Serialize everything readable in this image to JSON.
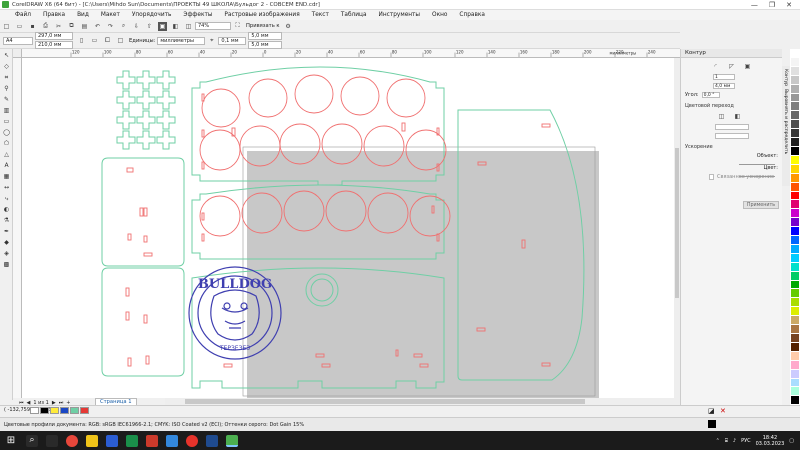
{
  "titlebar": {
    "title": "CorelDRAW X6 (64 бит) - [C:\\Users\\Mihdo Sun\\Documents\\ПРОЕКТЫ 49 ШКОЛА\\Бульдог 2 - СОВСЕМ END.cdr]",
    "minimize": "—",
    "maximize": "❐",
    "close": "✕"
  },
  "menu": [
    "Файл",
    "Правка",
    "Вид",
    "Макет",
    "Упорядочить",
    "Эффекты",
    "Растровые изображения",
    "Текст",
    "Таблица",
    "Инструменты",
    "Окно",
    "Справка"
  ],
  "toolbar": {
    "zoom": "74%",
    "snap": "Привязать к"
  },
  "propbar": {
    "page_size": "A4",
    "width": "297,0 мм",
    "height": "210,0 мм",
    "units_label": "Единицы:",
    "units_value": "миллиметры",
    "nudge": "0,1 мм",
    "dup_x": "5,0 мм",
    "dup_y": "5,0 мм"
  },
  "rulers": {
    "h_ticks": [
      "120",
      "100",
      "80",
      "60",
      "40",
      "20",
      "0",
      "20",
      "40",
      "60",
      "80",
      "100",
      "120",
      "140",
      "160",
      "180",
      "200",
      "220",
      "240"
    ],
    "h_unit": "миллиметры",
    "v_unit": "миллиметры"
  },
  "pagenav": {
    "page_info": "1 из 1",
    "page_tab": "Страница 1"
  },
  "status": {
    "coords": "( -132,759; 47,176 )",
    "color_profile": "Цветовые профили документа: RGB: sRGB IEC61966-2.1; CMYK: ISO Coated v2 (ECI); Оттенки серого: Dot Gain 15%"
  },
  "docker": {
    "title": "Контур",
    "field1": "1",
    "field2": "4,0 мм",
    "angle_label": "Угол:",
    "angle_value": "0,0 °",
    "transition_label": "Цветовой переход",
    "acceleration_label": "Ускорение",
    "object_label": "Объект:",
    "color_label": "Цвет:",
    "linked_label": "Связанное ускорение",
    "apply_label": "Применить",
    "tab1": "Контур",
    "tab2": "Выровнять и распределить"
  },
  "logo": {
    "text": "BULLDOG",
    "subtext": "ТЕРЗЕЗЕЗ"
  },
  "taskbar": {
    "lang": "РУС",
    "time": "18:42",
    "date": "03.03.2023"
  },
  "colors": {
    "cut_green": "#6fcfa5",
    "cut_red": "#f07070",
    "logo_blue": "#3f3fb0",
    "palette": [
      "#ffffff",
      "#f4f4f4",
      "#e0e0e0",
      "#c8c8c8",
      "#b0b0b0",
      "#989898",
      "#808080",
      "#686868",
      "#505050",
      "#383838",
      "#202020",
      "#000000",
      "#ffff00",
      "#ffd700",
      "#ff9900",
      "#ff5500",
      "#ff0000",
      "#e00070",
      "#cc00cc",
      "#7700cc",
      "#0000ff",
      "#0066ff",
      "#00aaff",
      "#00ccff",
      "#00e0cc",
      "#00cc66",
      "#00aa00",
      "#66cc00",
      "#aadd00",
      "#ddee00",
      "#ccaa66",
      "#aa7744",
      "#774422",
      "#552200",
      "#ffccaa",
      "#ffaacc",
      "#ccccff",
      "#aaddff",
      "#aaffdd",
      "#000000"
    ]
  }
}
